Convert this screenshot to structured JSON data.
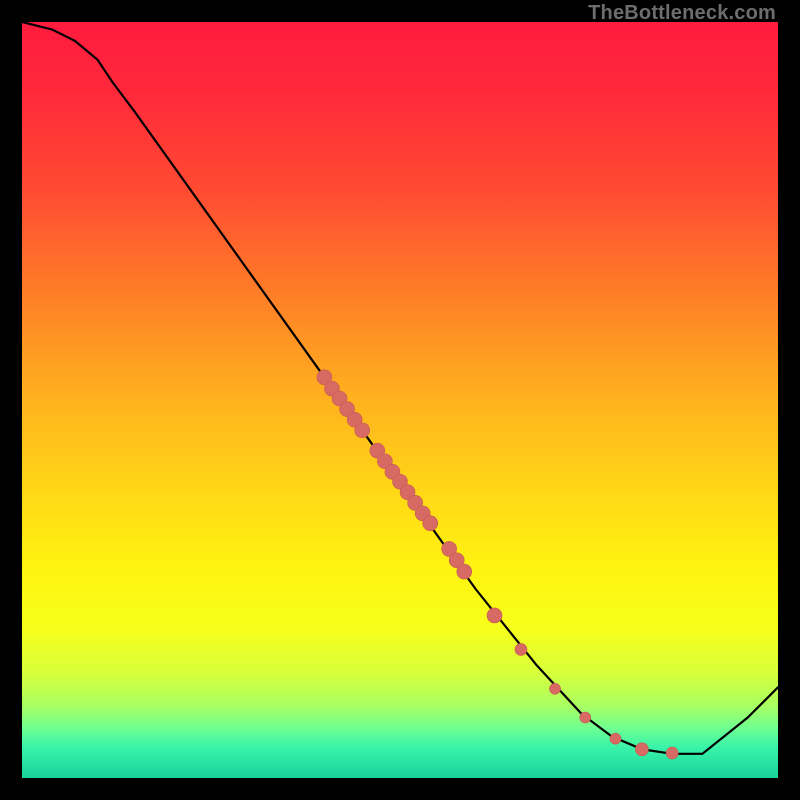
{
  "watermark": "TheBottleneck.com",
  "colors": {
    "gradient_stops": [
      {
        "offset": 0.0,
        "color": "#ff1b3f"
      },
      {
        "offset": 0.1,
        "color": "#ff2a3a"
      },
      {
        "offset": 0.22,
        "color": "#ff4a32"
      },
      {
        "offset": 0.35,
        "color": "#ff7a28"
      },
      {
        "offset": 0.5,
        "color": "#ffb21e"
      },
      {
        "offset": 0.62,
        "color": "#ffd716"
      },
      {
        "offset": 0.72,
        "color": "#fff310"
      },
      {
        "offset": 0.8,
        "color": "#f7ff1a"
      },
      {
        "offset": 0.86,
        "color": "#d8ff3a"
      },
      {
        "offset": 0.905,
        "color": "#a8ff62"
      },
      {
        "offset": 0.935,
        "color": "#6cff93"
      },
      {
        "offset": 0.96,
        "color": "#38f3a8"
      },
      {
        "offset": 1.0,
        "color": "#18d29a"
      }
    ],
    "curve": "#000000",
    "dot_fill": "#d76a62",
    "dot_stroke": "#c75a52"
  },
  "chart_data": {
    "type": "line",
    "title": "",
    "xlabel": "",
    "ylabel": "",
    "xlim": [
      0,
      100
    ],
    "ylim": [
      0,
      100
    ],
    "grid": false,
    "series": [
      {
        "name": "bottleneck-curve",
        "x": [
          0,
          4,
          7,
          10,
          12,
          15,
          40,
          60,
          68,
          74,
          78,
          82,
          86,
          90,
          96,
          100
        ],
        "y": [
          100,
          99,
          97.5,
          95,
          92,
          88,
          53,
          25,
          15,
          8.5,
          5.5,
          3.8,
          3.2,
          3.2,
          8,
          12
        ]
      }
    ],
    "points": [
      {
        "x": 40.0,
        "y": 53.0
      },
      {
        "x": 41.0,
        "y": 51.5
      },
      {
        "x": 42.0,
        "y": 50.2
      },
      {
        "x": 43.0,
        "y": 48.8
      },
      {
        "x": 44.0,
        "y": 47.4
      },
      {
        "x": 45.0,
        "y": 46.0
      },
      {
        "x": 47.0,
        "y": 43.3
      },
      {
        "x": 48.0,
        "y": 41.9
      },
      {
        "x": 49.0,
        "y": 40.5
      },
      {
        "x": 50.0,
        "y": 39.2
      },
      {
        "x": 51.0,
        "y": 37.8
      },
      {
        "x": 52.0,
        "y": 36.4
      },
      {
        "x": 53.0,
        "y": 35.0
      },
      {
        "x": 54.0,
        "y": 33.7
      },
      {
        "x": 56.5,
        "y": 30.3
      },
      {
        "x": 57.5,
        "y": 28.8
      },
      {
        "x": 58.5,
        "y": 27.3
      },
      {
        "x": 62.5,
        "y": 21.5
      },
      {
        "x": 66.0,
        "y": 17.0
      },
      {
        "x": 70.5,
        "y": 11.8
      },
      {
        "x": 74.5,
        "y": 8.0
      },
      {
        "x": 78.5,
        "y": 5.2
      },
      {
        "x": 82.0,
        "y": 3.8
      },
      {
        "x": 86.0,
        "y": 3.3
      }
    ],
    "point_radius_default": 7.5,
    "point_radius_overrides": {
      "18": 6.0,
      "19": 5.5,
      "20": 5.5,
      "21": 5.5,
      "22": 6.5,
      "23": 6.0
    }
  }
}
